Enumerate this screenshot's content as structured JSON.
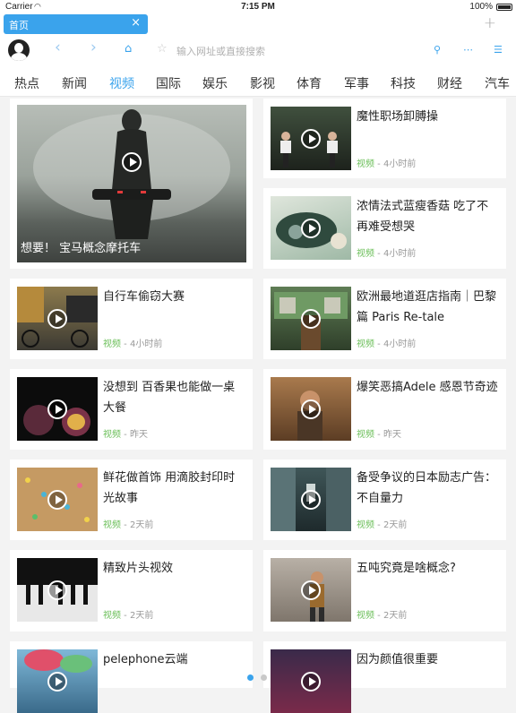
{
  "status": {
    "carrier": "Carrier",
    "time": "7:15 PM",
    "battery": "100%"
  },
  "tabs": [
    {
      "label": "首页",
      "close": "×"
    }
  ],
  "new_tab": "+",
  "toolbar": {
    "back": "‹",
    "forward": "›",
    "home": "⌂",
    "star": "☆",
    "search_placeholder": "输入网址或直接搜索",
    "search_icon": "⚲",
    "share_icon": "⋯",
    "menu_icon": "☰"
  },
  "categories": [
    "热点",
    "新闻",
    "视频",
    "国际",
    "娱乐",
    "影视",
    "体育",
    "军事",
    "科技",
    "财经",
    "汽车"
  ],
  "active_category": "视频",
  "featured": {
    "title": "想要！ 宝马概念摩托车"
  },
  "articles": [
    {
      "title": "魔性职场卸膊操",
      "source": "视频",
      "time": "4小时前"
    },
    {
      "title": "浓情法式蓝瘦香菇 吃了不再难受想哭",
      "source": "视频",
      "time": "4小时前"
    },
    {
      "title": "自行车偷窃大赛",
      "source": "视频",
      "time": "4小时前"
    },
    {
      "title": "欧洲最地道逛店指南｜巴黎篇 Paris Re-tale",
      "source": "视频",
      "time": "4小时前"
    },
    {
      "title": "没想到 百香果也能做一桌大餐",
      "source": "视频",
      "time": "昨天"
    },
    {
      "title": "爆笑恶搞Adele 感恩节奇迹",
      "source": "视频",
      "time": "昨天"
    },
    {
      "title": "鲜花做首饰 用滴胶封印时光故事",
      "source": "视频",
      "time": "2天前"
    },
    {
      "title": "备受争议的日本励志广告：不自量力",
      "source": "视频",
      "time": "2天前"
    },
    {
      "title": "精致片头视效",
      "source": "视频",
      "time": "2天前"
    },
    {
      "title": "五吨究竟是啥概念?",
      "source": "视频",
      "time": "2天前"
    },
    {
      "title": "pelephone云端",
      "source": "",
      "time": ""
    },
    {
      "title": "因为颜值很重要",
      "source": "",
      "time": ""
    }
  ],
  "meta_separator": " - ",
  "colors": {
    "accent": "#3aa3ec",
    "source": "#6bbf59"
  }
}
